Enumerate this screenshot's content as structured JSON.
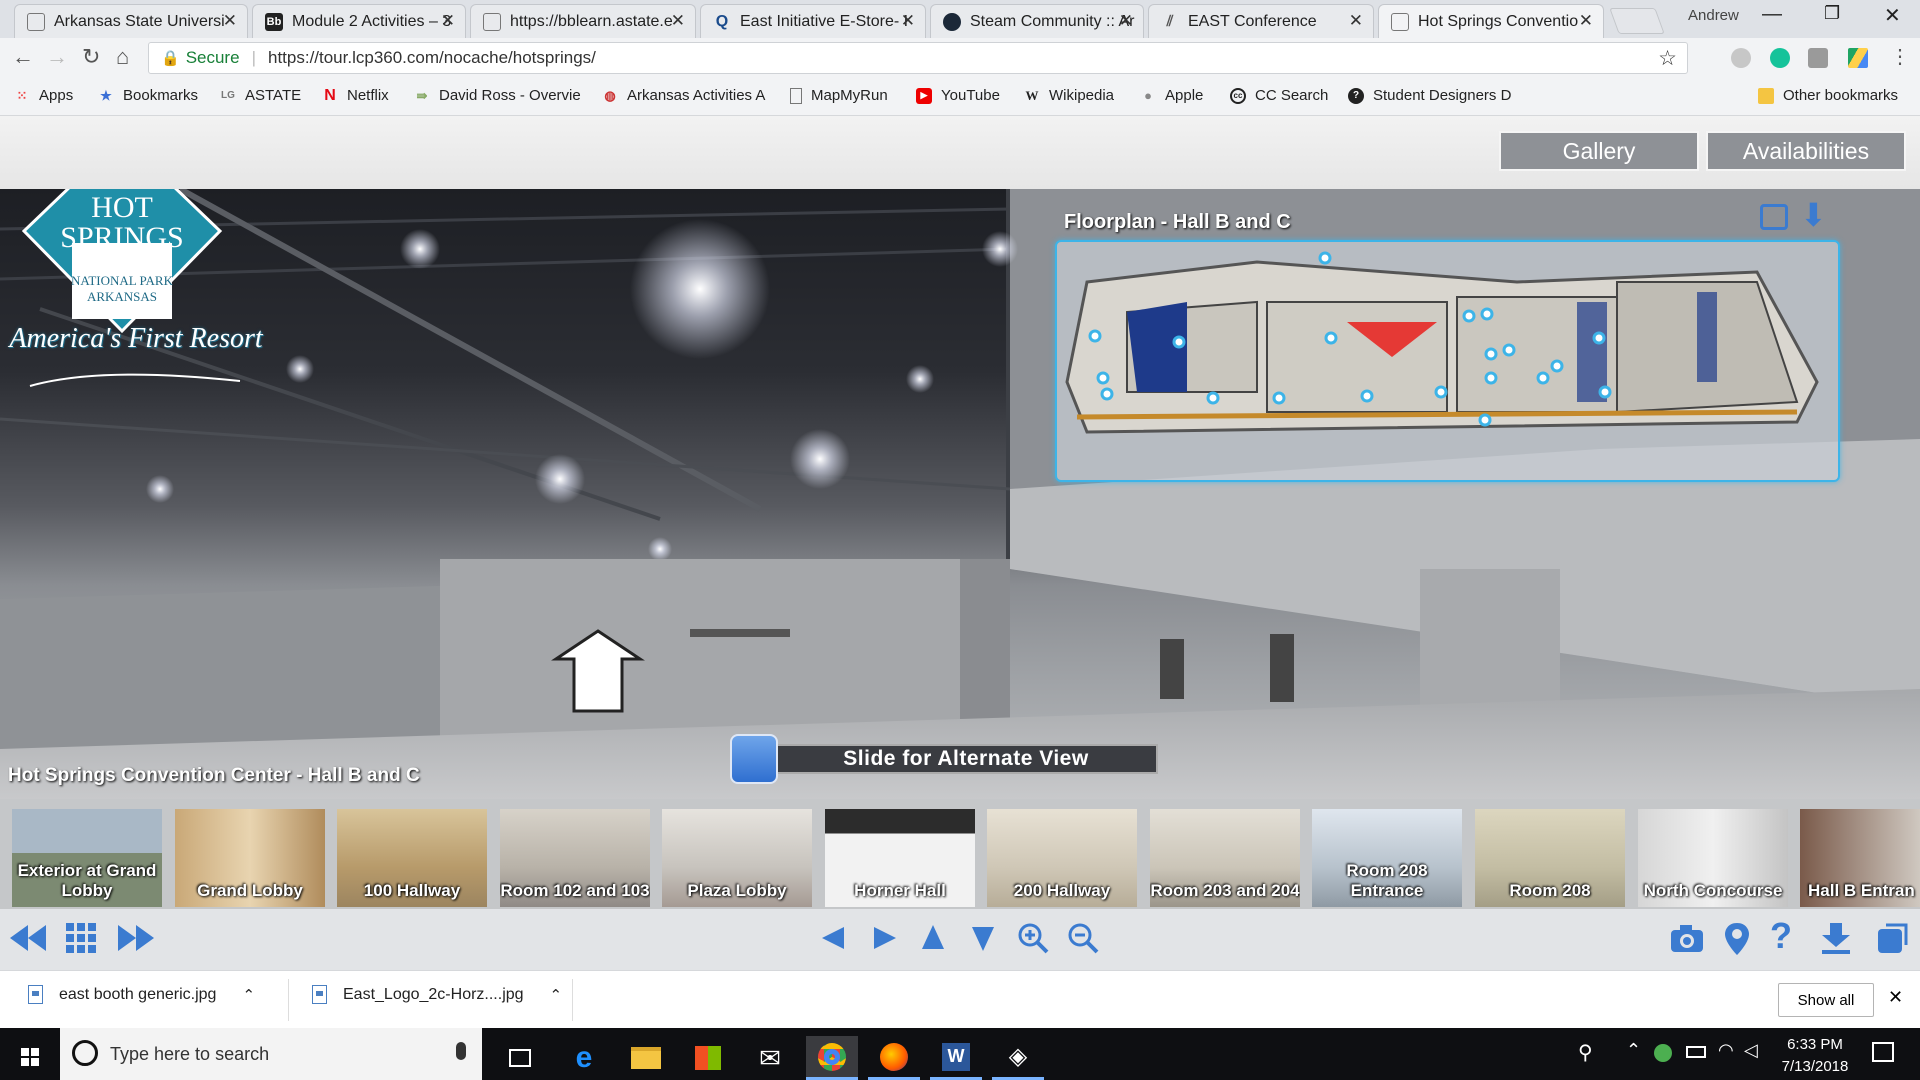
{
  "browser": {
    "tabs": [
      {
        "title": "Arkansas State Universi",
        "active": false
      },
      {
        "title": "Module 2 Activities – 3",
        "active": false
      },
      {
        "title": "https://bblearn.astate.e",
        "active": false
      },
      {
        "title": "East Initiative E-Store- I",
        "active": false
      },
      {
        "title": "Steam Community :: Ar",
        "active": false
      },
      {
        "title": "EAST Conference",
        "active": false
      },
      {
        "title": "Hot Springs Conventio",
        "active": true
      }
    ],
    "profile_name": "Andrew",
    "security_label": "Secure",
    "url": "https://tour.lcp360.com/nocache/hotsprings/",
    "bookmarks": [
      "Apps",
      "Bookmarks",
      "ASTATE",
      "Netflix",
      "David Ross - Overvie",
      "Arkansas Activities A",
      "MapMyRun",
      "YouTube",
      "Wikipedia",
      "Apple",
      "CC Search",
      "Student Designers D"
    ],
    "other_bookmarks": "Other bookmarks"
  },
  "tour": {
    "logo": {
      "line1": "HOT",
      "line2": "SPRINGS",
      "line3": "NATIONAL PARK",
      "line4": "ARKANSAS",
      "tagline": "America's First Resort"
    },
    "header_buttons": {
      "gallery": "Gallery",
      "availabilities": "Availabilities"
    },
    "floorplan_title": "Floorplan - Hall B and C",
    "location_title": "Hot Springs Convention Center - Hall B and C",
    "slider_label": "Slide for Alternate View",
    "thumbnails": [
      "Exterior at Grand Lobby",
      "Grand Lobby",
      "100 Hallway",
      "Room 102 and 103",
      "Plaza Lobby",
      "Horner Hall",
      "200 Hallway",
      "Room 203 and 204",
      "Room 208 Entrance",
      "Room 208",
      "North Concourse",
      "Hall B Entran"
    ]
  },
  "downloads": {
    "items": [
      "east booth generic.jpg",
      "East_Logo_2c-Horz....jpg"
    ],
    "show_all": "Show all"
  },
  "taskbar": {
    "search_placeholder": "Type here to search",
    "time": "6:33 PM",
    "date": "7/13/2018"
  },
  "colors": {
    "accent": "#3b7bd0",
    "floorplan_border": "#3db4e8",
    "logo_teal": "#1f8fa8"
  }
}
